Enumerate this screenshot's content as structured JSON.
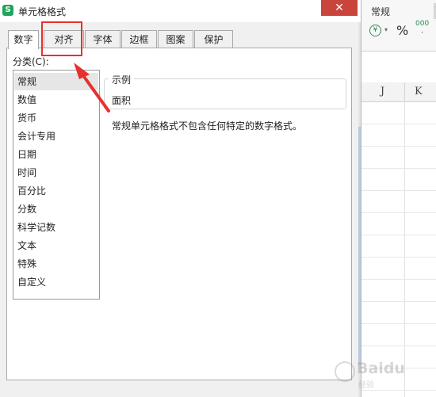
{
  "dialog": {
    "title": "单元格格式",
    "app_logo": "S",
    "close_glyph": "✕",
    "tabs": [
      "数字",
      "对齐",
      "字体",
      "边框",
      "图案",
      "保护"
    ],
    "active_tab": "数字",
    "category_label": "分类(C):",
    "categories": [
      "常规",
      "数值",
      "货币",
      "会计专用",
      "日期",
      "时间",
      "百分比",
      "分数",
      "科学记数",
      "文本",
      "特殊",
      "自定义"
    ],
    "selected_category": "常规",
    "sample_legend": "示例",
    "sample_value": "面积",
    "description": "常规单元格格式不包含任何特定的数字格式。"
  },
  "sheet": {
    "format_label": "常规",
    "currency_symbol": "¥",
    "dropdown_glyph": "▾",
    "percent_symbol": "%",
    "comma_glyph": "000\n,",
    "columns": [
      "J",
      "K"
    ]
  },
  "annotation": {
    "color": "#e6312f",
    "highlight_target": "对齐"
  },
  "watermark": {
    "brand": "Baidu",
    "sub": "经验"
  },
  "colors": {
    "app_green": "#21a55c",
    "close_red": "#c9443a",
    "selected_bg": "#e6e6e6"
  }
}
